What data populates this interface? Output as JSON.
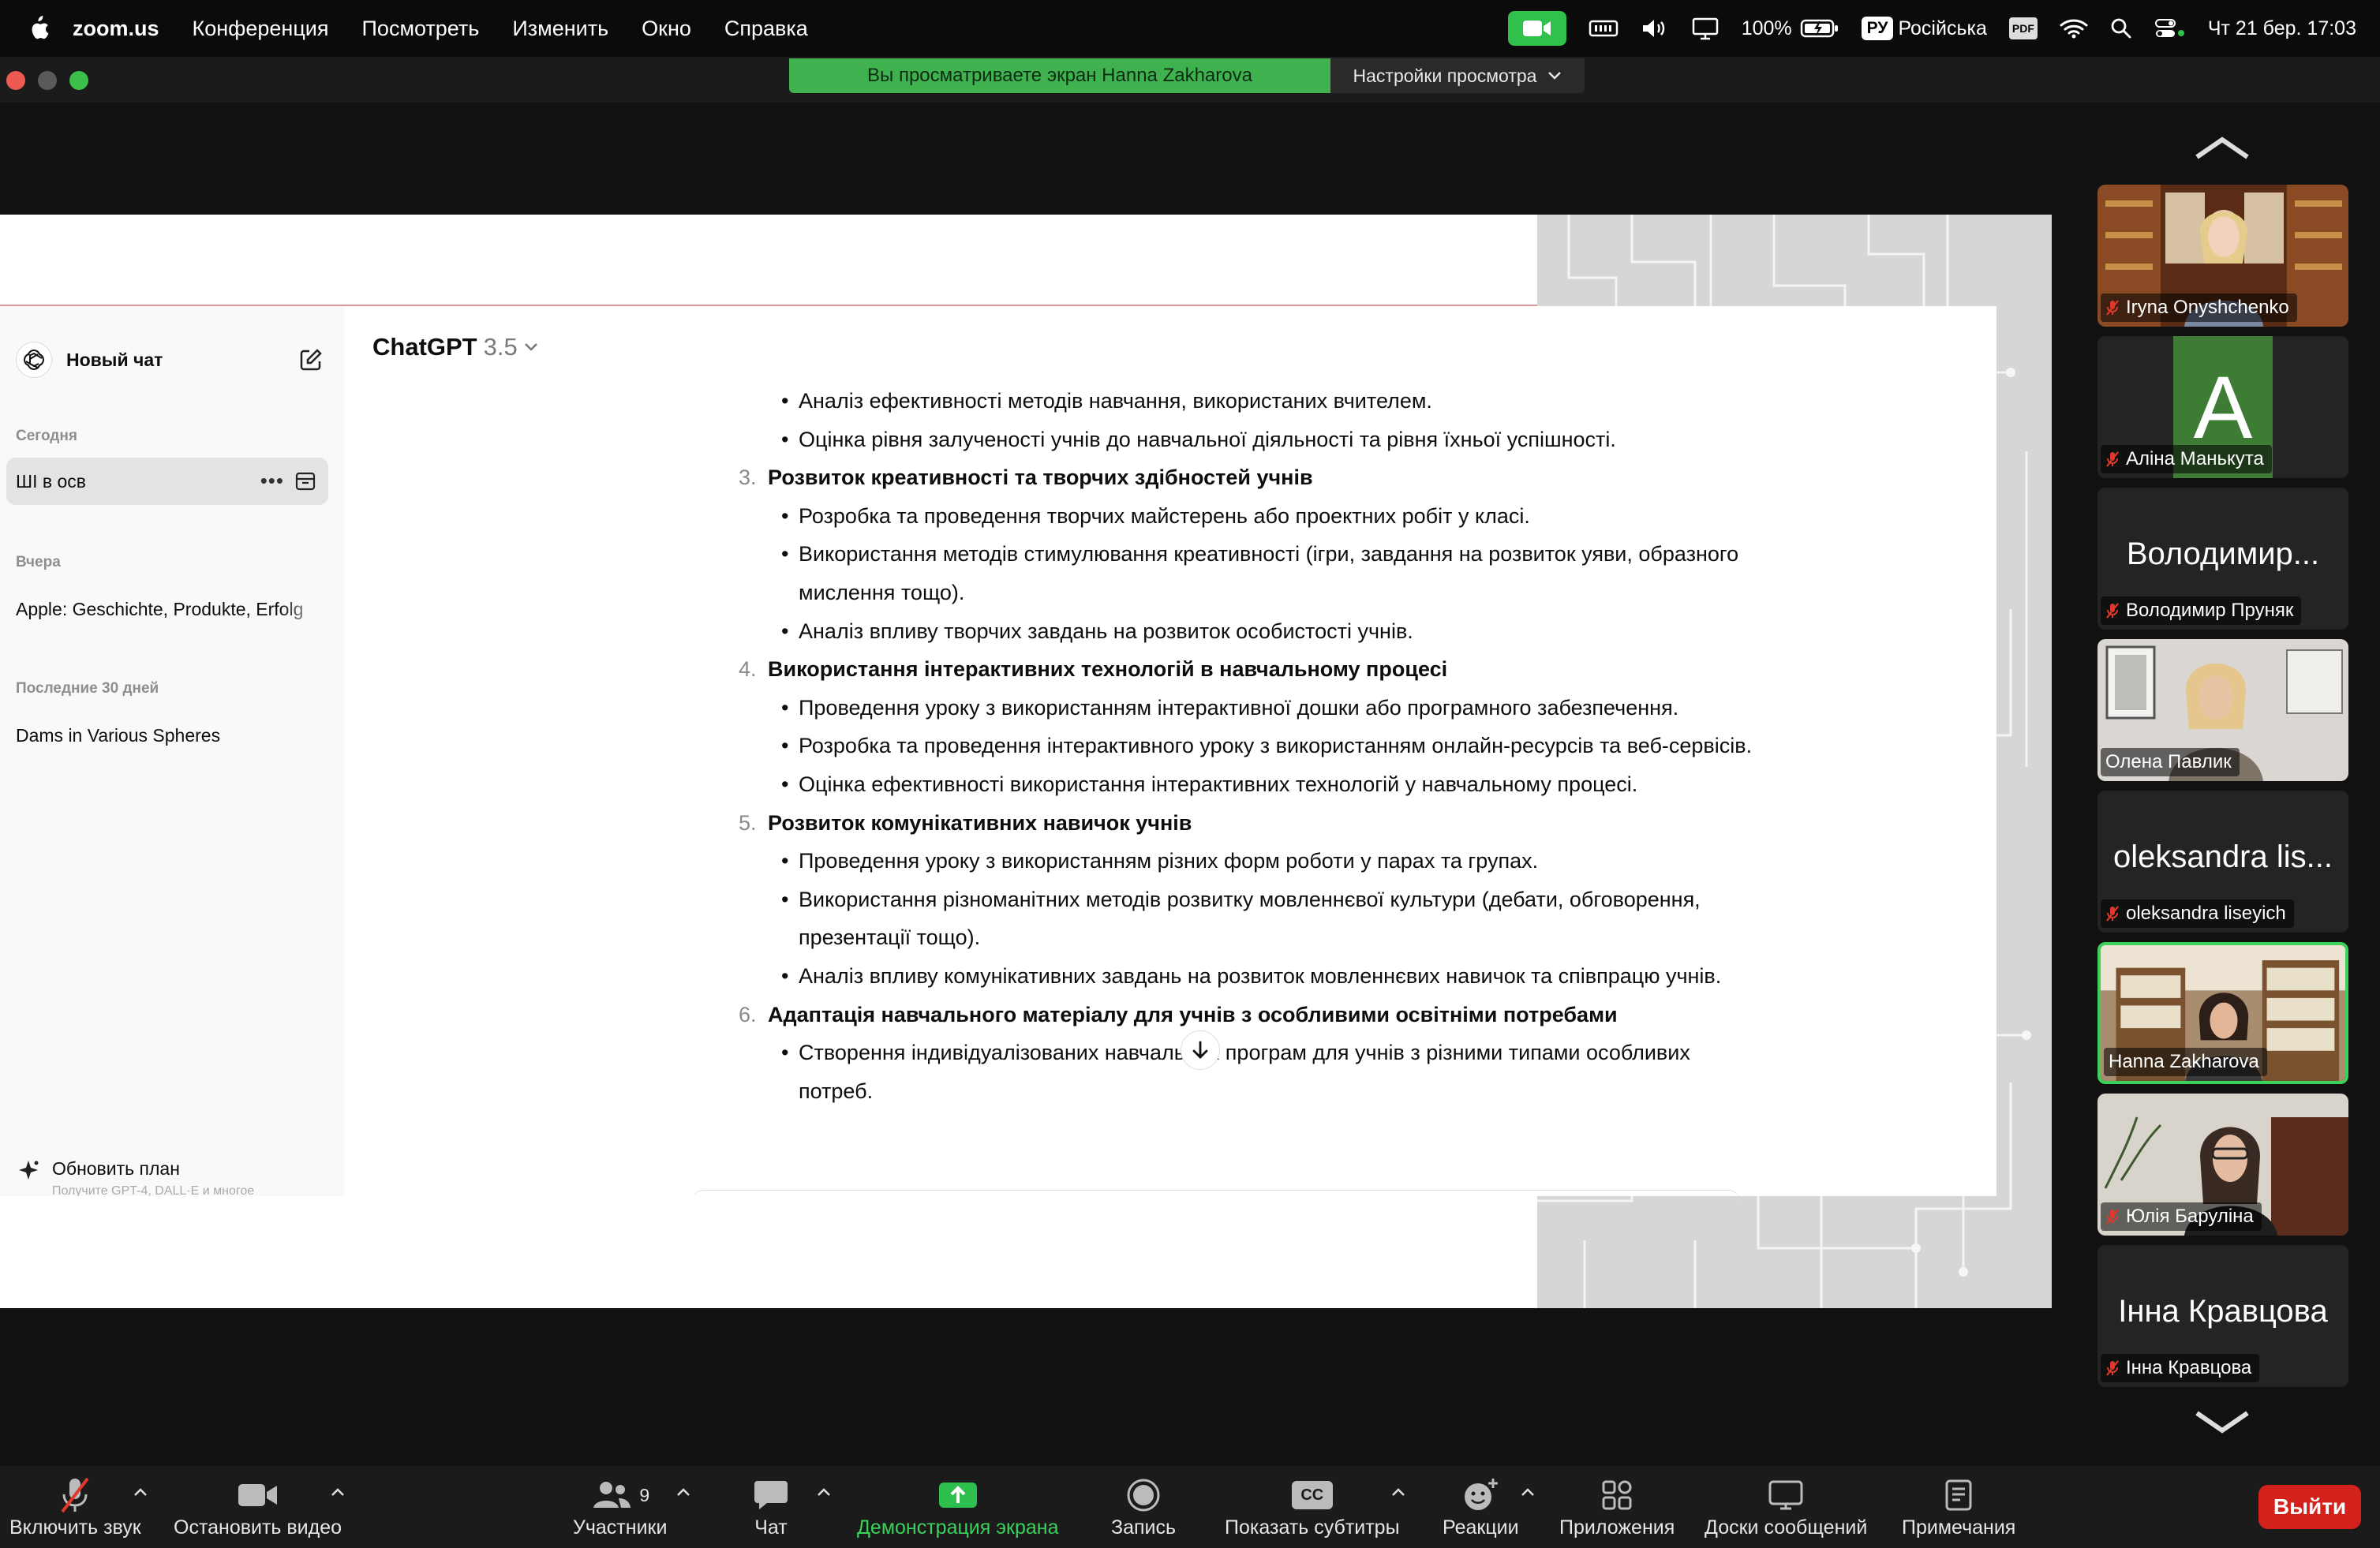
{
  "menubar": {
    "app_name": "zoom.us",
    "menus": [
      "Конференция",
      "Посмотреть",
      "Изменить",
      "Окно",
      "Справка"
    ],
    "battery": "100%",
    "input_source_badge": "РУ",
    "input_source": "Російська",
    "pdf_badge": "PDF",
    "datetime": "Чт 21 бер.  17:03"
  },
  "share": {
    "banner": "Вы просматриваете экран Hanna Zakharova",
    "view_settings": "Настройки просмотра"
  },
  "chatgpt": {
    "new_chat": "Новый чат",
    "sections": [
      {
        "label": "Сегодня",
        "items": [
          "ШІ в осв"
        ]
      },
      {
        "label": "Вчера",
        "items": [
          "Apple: Geschichte, Produkte, Erfolg"
        ]
      },
      {
        "label": "Последние 30 дней",
        "items": [
          "Dams in Various Spheres"
        ]
      }
    ],
    "upgrade_title": "Обновить план",
    "upgrade_sub": "Получите GPT-4, DALL·E и многое",
    "model_name": "ChatGPT",
    "model_version": "3.5",
    "lines": [
      {
        "type": "bullet",
        "text": "Аналіз ефективності методів навчання, використаних вчителем."
      },
      {
        "type": "bullet",
        "text": "Оцінка рівня залученості учнів до навчальної діяльності та рівня їхньої успішності."
      },
      {
        "type": "heading",
        "num": "3.",
        "text": "Розвиток креативності та творчих здібностей учнів"
      },
      {
        "type": "bullet",
        "text": "Розробка та проведення творчих майстерень або проектних робіт у класі."
      },
      {
        "type": "bullet",
        "text": "Використання методів стимулювання креативності (ігри, завдання на розвиток уяви, образного мислення тощо)."
      },
      {
        "type": "bullet",
        "text": "Аналіз впливу творчих завдань на розвиток особистості учнів."
      },
      {
        "type": "heading",
        "num": "4.",
        "text": "Використання інтерактивних технологій в навчальному процесі"
      },
      {
        "type": "bullet",
        "text": "Проведення уроку з використанням інтерактивної дошки або програмного забезпечення."
      },
      {
        "type": "bullet",
        "text": "Розробка та проведення інтерактивного уроку з використанням онлайн-ресурсів та веб-сервісів."
      },
      {
        "type": "bullet",
        "text": "Оцінка ефективності використання інтерактивних технологій у навчальному процесі."
      },
      {
        "type": "heading",
        "num": "5.",
        "text": "Розвиток комунікативних навичок учнів"
      },
      {
        "type": "bullet",
        "text": "Проведення уроку з використанням різних форм роботи у парах та групах."
      },
      {
        "type": "bullet",
        "text": "Використання різноманітних методів розвитку мовленнєвої культури (дебати, обговорення, презентації тощо)."
      },
      {
        "type": "bullet",
        "text": "Аналіз впливу комунікативних завдань на розвиток мовленнєвих навичок та співпрацю учнів."
      },
      {
        "type": "heading",
        "num": "6.",
        "text": "Адаптація навчального матеріалу для учнів з особливими освітніми потребами"
      },
      {
        "type": "bullet",
        "text": "Створення індивідуалізованих навчальних програм для учнів з різними типами особливих потреб."
      }
    ]
  },
  "participants": [
    {
      "name": "Iryna Onyshchenko",
      "muted": true,
      "video": "library"
    },
    {
      "name": "Аліна Манькута",
      "muted": true,
      "avatar_letter": "A",
      "avatar_color": "#3e7c35"
    },
    {
      "name": "Володимир Пруняк",
      "muted": true,
      "display": "Володимир..."
    },
    {
      "name": "Олена Павлик",
      "muted": false,
      "video": "office"
    },
    {
      "name": "oleksandra liseyich",
      "muted": true,
      "display": "oleksandra lis..."
    },
    {
      "name": "Hanna Zakharova",
      "muted": false,
      "video": "shelves",
      "active_speaker": true
    },
    {
      "name": "Юлія Баруліна",
      "muted": true,
      "video": "room"
    },
    {
      "name": "Інна Кравцова",
      "muted": true,
      "display": "Інна Кравцова"
    }
  ],
  "toolbar": {
    "unmute": "Включить звук",
    "stop_video": "Остановить видео",
    "participants": "Участники",
    "participants_count": "9",
    "chat": "Чат",
    "share_screen": "Демонстрация экрана",
    "record": "Запись",
    "captions": "Показать субтитры",
    "cc": "CC",
    "reactions": "Реакции",
    "apps": "Приложения",
    "whiteboards": "Доски сообщений",
    "notes": "Примечания",
    "leave": "Выйти"
  },
  "colors": {
    "share_green": "#3fb24f",
    "active_border": "#3ad25b",
    "leave_red": "#d3221c",
    "mute_red": "#e0382c"
  }
}
